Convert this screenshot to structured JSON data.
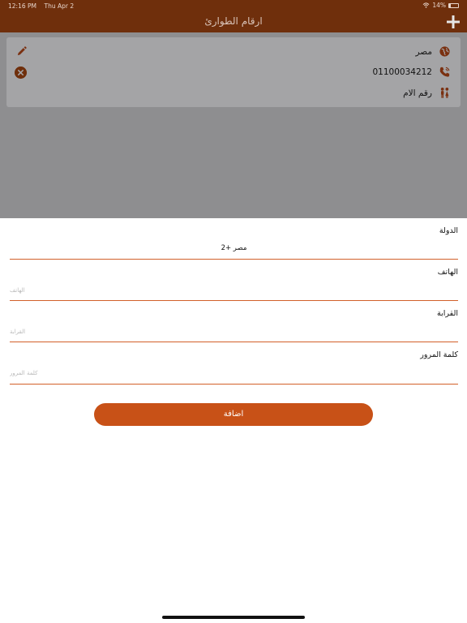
{
  "status_bar": {
    "time": "12:16 PM",
    "date": "Thu Apr 2",
    "battery": "14%",
    "wifi_icon": "wifi-icon",
    "battery_icon": "battery-icon"
  },
  "nav": {
    "title": "ارقام الطوارئ",
    "add_icon": "plus-icon"
  },
  "contact_card": {
    "country": "مصر",
    "phone": "01100034212",
    "relation": "رقم الام",
    "icons": [
      "globe-icon",
      "phone-icon",
      "people-icon",
      "pencil-icon",
      "close-circle-icon"
    ]
  },
  "form": {
    "country_label": "الدولة",
    "country_value": "مصر +2",
    "phone_label": "الهاتف",
    "phone_placeholder": "الهاتف",
    "relation_label": "القرابة",
    "relation_placeholder": "القرابة",
    "password_label": "كلمة المرور",
    "password_placeholder": "كلمة المرور",
    "submit_label": "اضافة"
  },
  "colors": {
    "header": "#6f2f0c",
    "accent": "#c85117",
    "line": "#d2602a",
    "dim_overlay": "#8e8e90"
  }
}
